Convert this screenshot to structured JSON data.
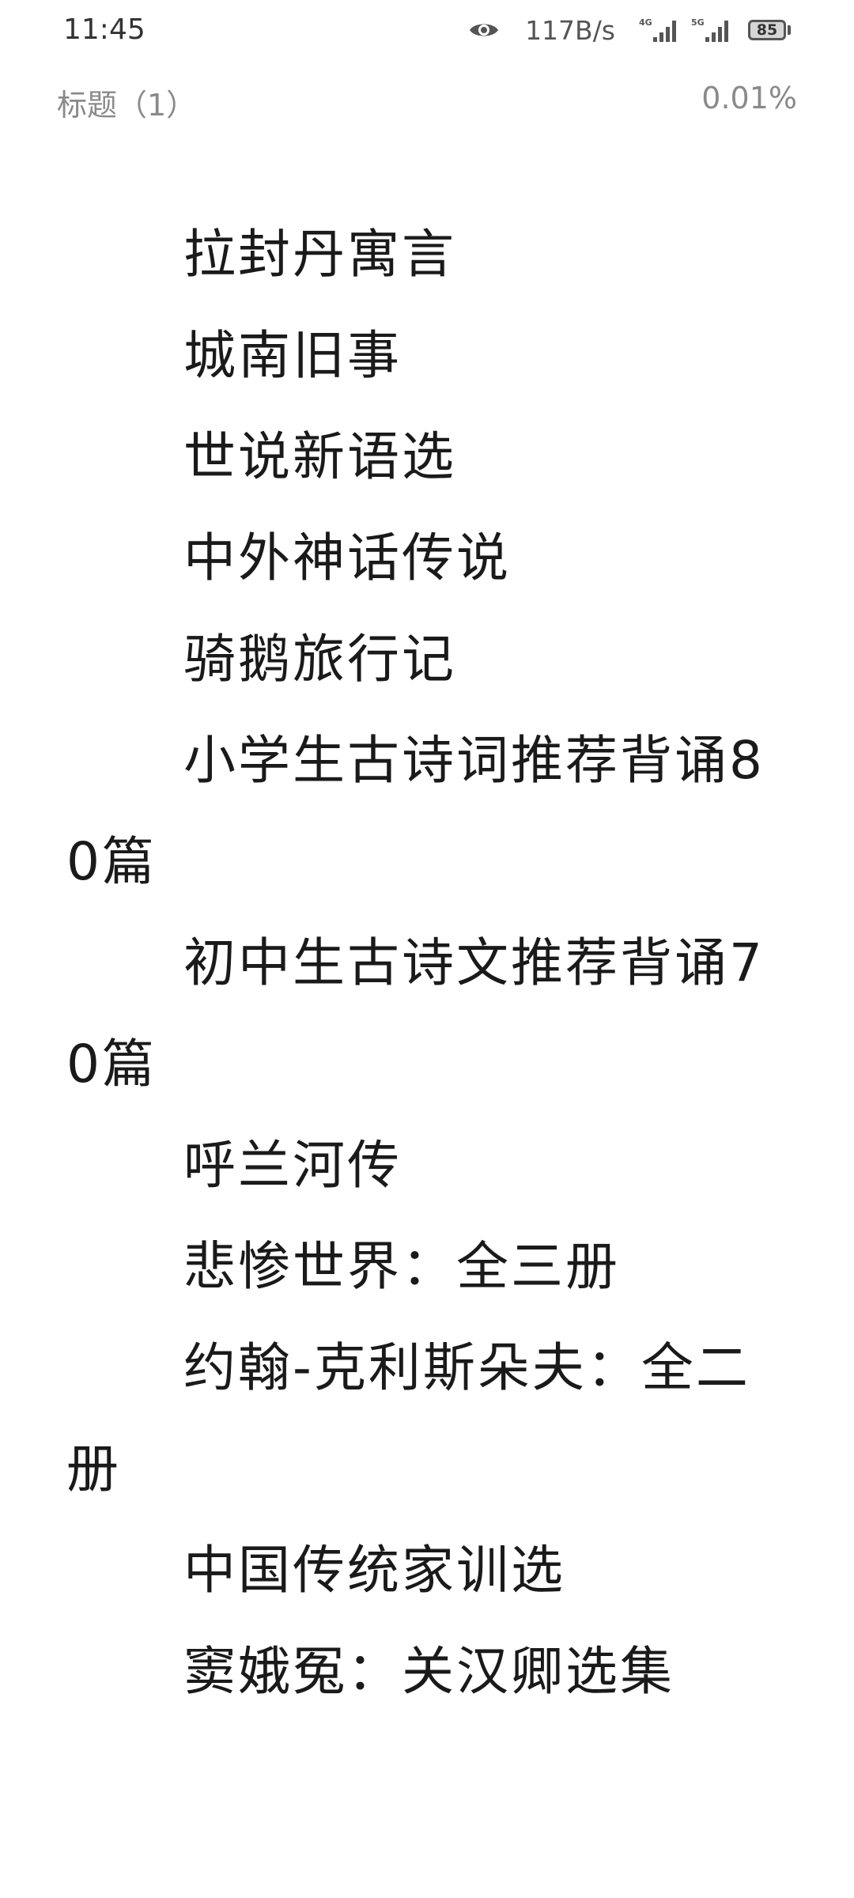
{
  "status_bar": {
    "time": "11:45",
    "net_speed": "117B/s",
    "signal_4g": "4G",
    "signal_5g": "5G",
    "battery": "85",
    "icons": [
      "eye-icon",
      "signal-4g-icon",
      "signal-5g-icon",
      "battery-icon"
    ]
  },
  "reader": {
    "chapter_title": "标题（1）",
    "progress": "0.01%"
  },
  "content": {
    "paragraphs": [
      "拉封丹寓言",
      "城南旧事",
      "世说新语选",
      "中外神话传说",
      "骑鹅旅行记",
      "小学生古诗词推荐背诵80篇",
      "初中生古诗文推荐背诵70篇",
      "呼兰河传",
      "悲惨世界：全三册",
      "约翰-克利斯朵夫：全二册",
      "中国传统家训选",
      "窦娥冤：关汉卿选集"
    ]
  }
}
